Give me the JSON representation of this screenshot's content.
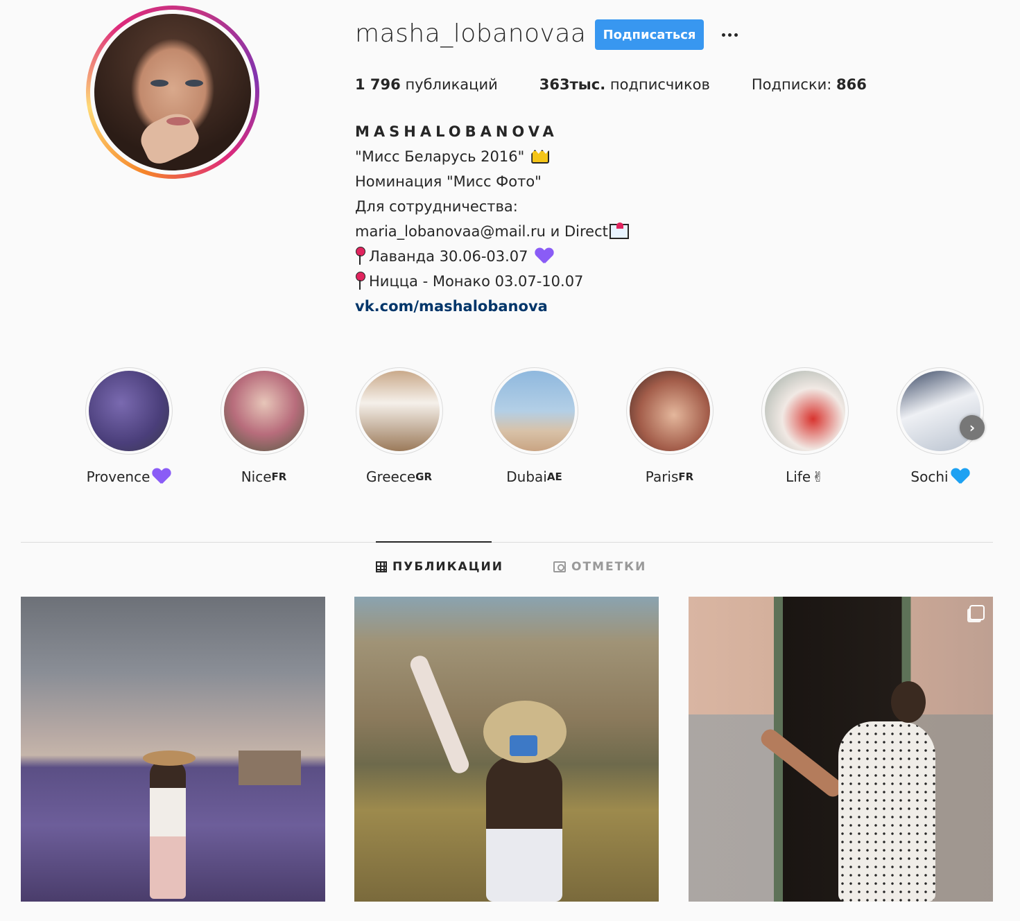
{
  "profile": {
    "username": "masha_lobanovaa",
    "follow_label": "Подписаться",
    "stats": {
      "posts_count": "1 796",
      "posts_label": " публикаций",
      "followers_count": "363тыс.",
      "followers_label": " подписчиков",
      "following_label": "Подписки: ",
      "following_count": "866"
    },
    "bio": {
      "full_name": "MASHALOBANOVA",
      "line1": "\"Мисс Беларусь 2016\"",
      "line2": "Номинация \"Мисс Фото\"",
      "line3": "Для сотрудничества:",
      "line4": "maria_lobanovaa@mail.ru и Direct",
      "line5": "Лаванда 30.06-03.07",
      "line6": "Ницца - Монако 03.07-10.07",
      "link": "vk.com/mashalobanova"
    }
  },
  "highlights": [
    {
      "name": "Provence",
      "suffix": "",
      "emoji": "purple-heart"
    },
    {
      "name": "Nice",
      "suffix": "FR",
      "emoji": ""
    },
    {
      "name": "Greece",
      "suffix": "GR",
      "emoji": ""
    },
    {
      "name": "Dubai",
      "suffix": "AE",
      "emoji": ""
    },
    {
      "name": "Paris",
      "suffix": "FR",
      "emoji": ""
    },
    {
      "name": "Life",
      "suffix": "",
      "emoji": "victory-hand"
    },
    {
      "name": "Sochi",
      "suffix": "",
      "emoji": "blue-heart"
    }
  ],
  "tabs": {
    "posts_label": "ПУБЛИКАЦИИ",
    "tagged_label": "ОТМЕТКИ"
  },
  "colors": {
    "accent": "#3897f0",
    "link": "#003569",
    "purple_heart": "#8a5cf6",
    "blue_heart": "#1da1f2"
  }
}
